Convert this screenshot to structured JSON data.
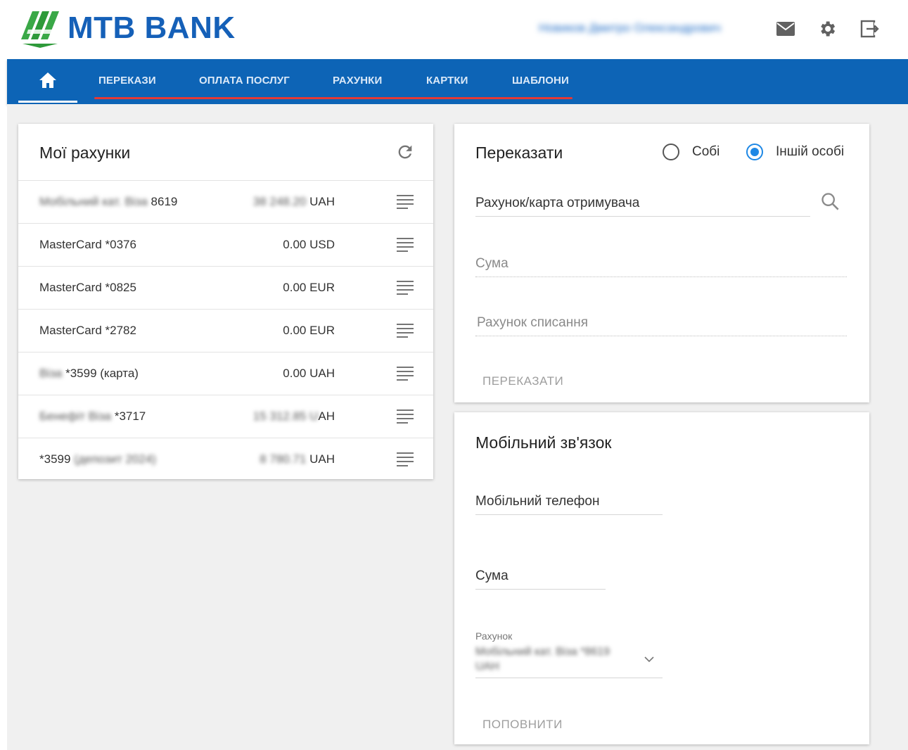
{
  "header": {
    "brand": "MTB BANK",
    "user_name": "Новиков Дмитро Олександрович",
    "icons": [
      "mail-icon",
      "gear-icon",
      "logout-icon"
    ]
  },
  "nav": {
    "home_icon": "home-icon",
    "items": [
      "ПЕРЕКАЗИ",
      "ОПЛАТА ПОСЛУГ",
      "РАХУНКИ",
      "КАРТКИ",
      "ШАБЛОНИ"
    ]
  },
  "accounts": {
    "title": "Мої рахунки",
    "rows": [
      {
        "name_blurred": "Мобільний кат. Віза ",
        "name": "8619",
        "amount_blurred": "38 248.20 ",
        "currency": "UAH"
      },
      {
        "name_blurred": "",
        "name": "MasterCard *0376",
        "amount_blurred": "",
        "amount": "0.00",
        "currency": "USD"
      },
      {
        "name_blurred": "",
        "name": "MasterCard *0825",
        "amount_blurred": "",
        "amount": "0.00",
        "currency": "EUR"
      },
      {
        "name_blurred": "",
        "name": "MasterCard *2782",
        "amount_blurred": "",
        "amount": "0.00",
        "currency": "EUR"
      },
      {
        "name_blurred": "Віза ",
        "name": "*3599 (карта)",
        "amount_blurred": "",
        "amount": "0.00",
        "currency": "UAH"
      },
      {
        "name_blurred": "Бенефіт Віза ",
        "name": "*3717",
        "amount_blurred": "15 312.85 U",
        "currency": "AH"
      },
      {
        "name_blurred": " (депозит 2024)",
        "name": "*3599",
        "amount_blurred": "8 780.71 ",
        "currency": "UAH",
        "suffix_blur": true
      }
    ]
  },
  "transfer": {
    "title": "Переказати",
    "radio_self": "Собі",
    "radio_other": "Іншій особі",
    "recipient_placeholder": "Рахунок/карта отримувача",
    "amount_placeholder": "Сума",
    "debit_placeholder": "Рахунок списання",
    "submit": "ПЕРЕКАЗАТИ"
  },
  "mobile": {
    "title": "Мобільний зв'язок",
    "phone_placeholder": "Мобільний телефон",
    "amount_placeholder": "Сума",
    "account_label": "Рахунок",
    "account_value": "Мобільний кат. Віза *8619 UAH",
    "submit": "ПОПОВНИТИ"
  }
}
